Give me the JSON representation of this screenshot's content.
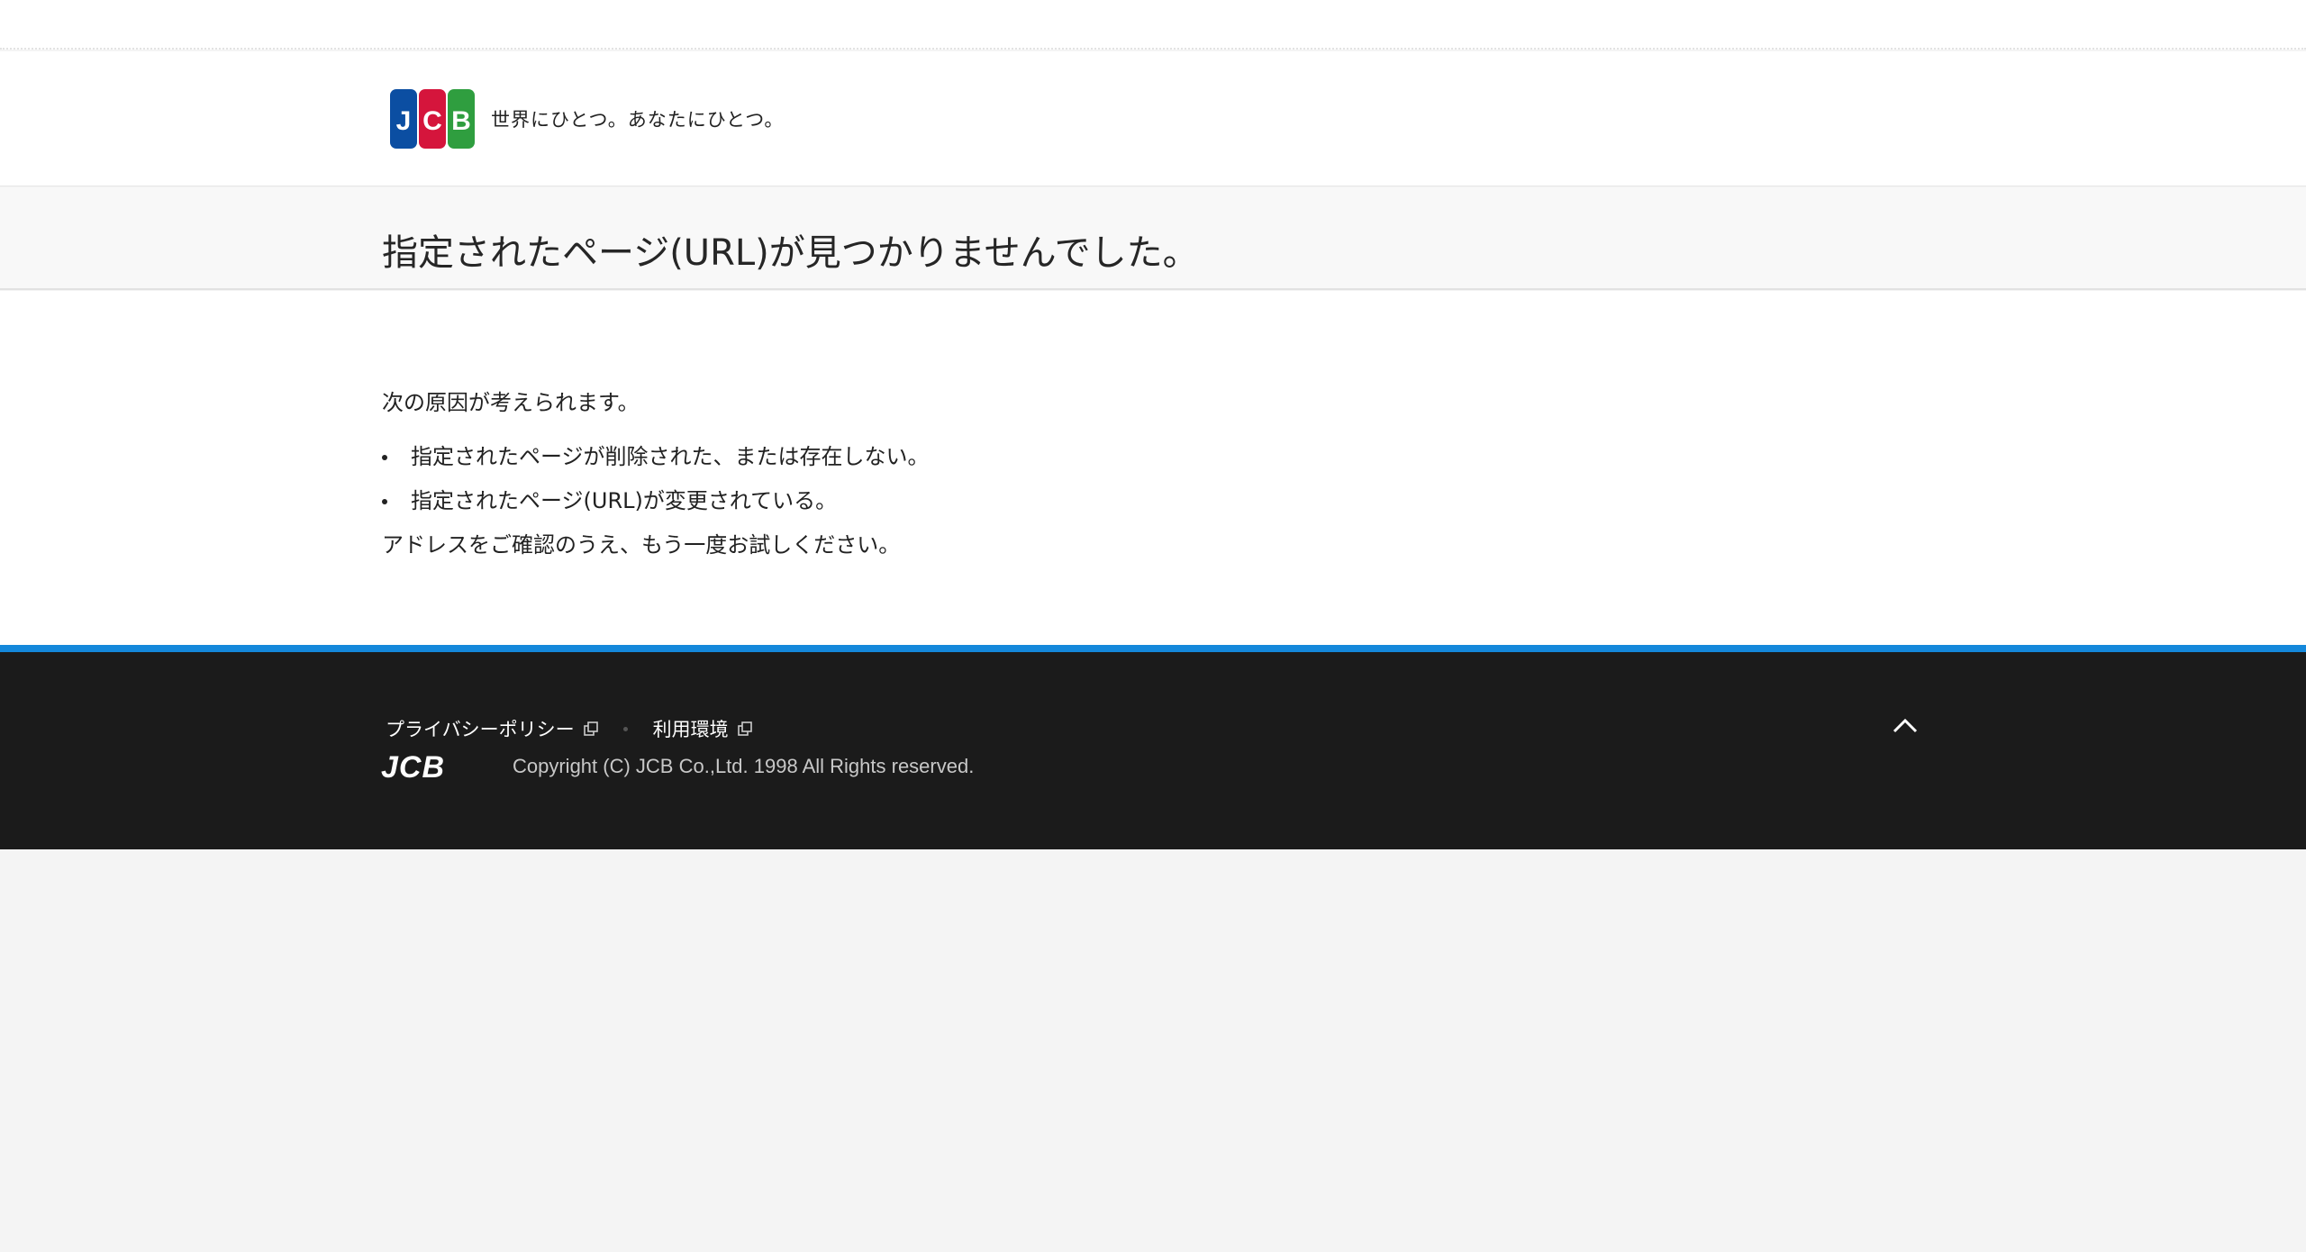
{
  "header": {
    "logo_label": "JCB",
    "tagline": "世界にひとつ。あなたにひとつ。"
  },
  "error": {
    "title": "指定されたページ(URL)が見つかりませんでした。",
    "intro": "次の原因が考えられます。",
    "causes": [
      "指定されたページが削除された、または存在しない。",
      "指定されたページ(URL)が変更されている。"
    ],
    "advice": "アドレスをご確認のうえ、もう一度お試しください。"
  },
  "footer": {
    "links": [
      {
        "label": "プライバシーポリシー",
        "icon": "external-link-icon"
      },
      {
        "label": "利用環境",
        "icon": "external-link-icon"
      }
    ],
    "logo_label": "JCB",
    "copyright": "Copyright (C) JCB Co.,Ltd. 1998 All Rights reserved.",
    "pagetop_icon": "chevron-up-icon"
  },
  "colors": {
    "accent_blue": "#1488db",
    "footer_bg": "#1b1b1b",
    "jcb_blue": "#0b4ea2",
    "jcb_red": "#d5153c",
    "jcb_green": "#2f9e3f"
  }
}
